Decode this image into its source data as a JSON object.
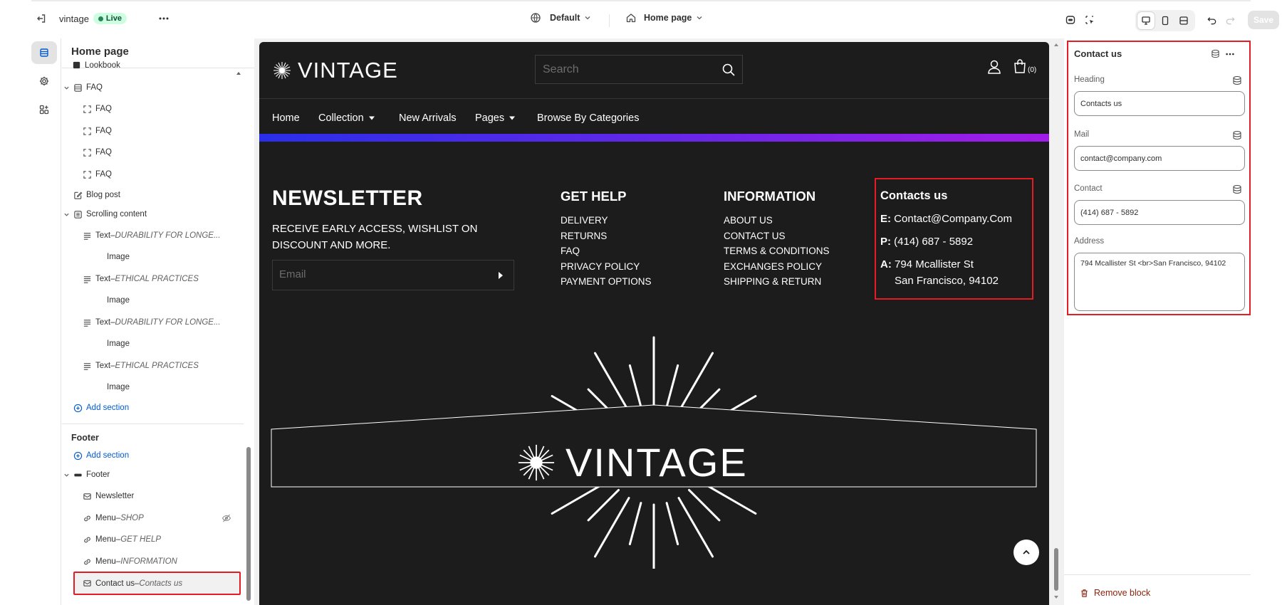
{
  "topbar": {
    "store_name": "vintage",
    "live_label": "Live",
    "theme_label": "Default",
    "page_label": "Home page",
    "save_label": "Save"
  },
  "sidebar": {
    "title": "Home page",
    "items": [
      {
        "label": "Lookbook",
        "sub": ""
      },
      {
        "label": "FAQ",
        "sub": ""
      },
      {
        "label": "FAQ",
        "sub": ""
      },
      {
        "label": "FAQ",
        "sub": ""
      },
      {
        "label": "FAQ",
        "sub": ""
      },
      {
        "label": "FAQ",
        "sub": ""
      },
      {
        "label": "Blog post",
        "sub": ""
      },
      {
        "label": "Scrolling content",
        "sub": ""
      },
      {
        "label": "Text",
        "sub": "DURABILITY FOR LONGE..."
      },
      {
        "label": "Image",
        "sub": ""
      },
      {
        "label": "Text",
        "sub": "ETHICAL PRACTICES"
      },
      {
        "label": "Image",
        "sub": ""
      },
      {
        "label": "Text",
        "sub": "DURABILITY FOR LONGE..."
      },
      {
        "label": "Image",
        "sub": ""
      },
      {
        "label": "Text",
        "sub": "ETHICAL PRACTICES"
      },
      {
        "label": "Image",
        "sub": ""
      }
    ],
    "add_section_label": "Add section",
    "footer_group_label": "Footer",
    "footer_items": [
      {
        "label": "Footer",
        "sub": ""
      },
      {
        "label": "Newsletter",
        "sub": ""
      },
      {
        "label": "Menu",
        "sub": "SHOP"
      },
      {
        "label": "Menu",
        "sub": "GET HELP"
      },
      {
        "label": "Menu",
        "sub": "INFORMATION"
      },
      {
        "label": "Contact us",
        "sub": "Contacts us"
      }
    ],
    "separator": " – "
  },
  "preview": {
    "brand": "VINTAGE",
    "search_placeholder": "Search",
    "cart_count": "(0)",
    "nav": [
      "Home",
      "Collection",
      "New Arrivals",
      "Pages",
      "Browse By Categories"
    ],
    "newsletter_title": "NEWSLETTER",
    "newsletter_sub": "RECEIVE EARLY ACCESS, WISHLIST ON DISCOUNT AND MORE.",
    "email_placeholder": "Email",
    "get_help_title": "GET HELP",
    "get_help_links": [
      "DELIVERY",
      "RETURNS",
      "FAQ",
      "PRIVACY POLICY",
      "PAYMENT OPTIONS"
    ],
    "information_title": "INFORMATION",
    "information_links": [
      "ABOUT US",
      "CONTACT US",
      "TERMS & CONDITIONS",
      "EXCHANGES POLICY",
      "SHIPPING & RETURN"
    ],
    "contacts_title": "Contacts us",
    "contact_email_prefix": "E:",
    "contact_email": "Contact@Company.Com",
    "contact_phone_prefix": "P:",
    "contact_phone": "(414) 687 - 5892",
    "contact_address_prefix": "A:",
    "contact_address_line1": "794 Mcallister St",
    "contact_address_line2": "San Francisco, 94102",
    "footer_brand": "VINTAGE"
  },
  "panel": {
    "title": "Contact us",
    "heading_label": "Heading",
    "heading_value": "Contacts us",
    "mail_label": "Mail",
    "mail_value": "contact@company.com",
    "contact_label": "Contact",
    "contact_value": "(414) 687 - 5892",
    "address_label": "Address",
    "address_value": "794 Mcallister St <br>San Francisco, 94102",
    "remove_label": "Remove block"
  },
  "colors": {
    "highlight": "#e51c23",
    "link": "#005bd3",
    "preview_bg": "#1c1c1c",
    "gradient_start": "#2a2ee8",
    "gradient_end": "#a21ce8",
    "danger": "#8e1f0b"
  },
  "icons": {
    "exit": "exit-icon",
    "more": "more-horizontal-icon",
    "theme": "globe-icon",
    "home": "home-icon",
    "search": "search-icon",
    "user": "user-icon",
    "cart": "bag-icon",
    "undo": "undo-icon",
    "redo": "redo-icon",
    "database": "database-icon",
    "trash": "trash-icon"
  }
}
